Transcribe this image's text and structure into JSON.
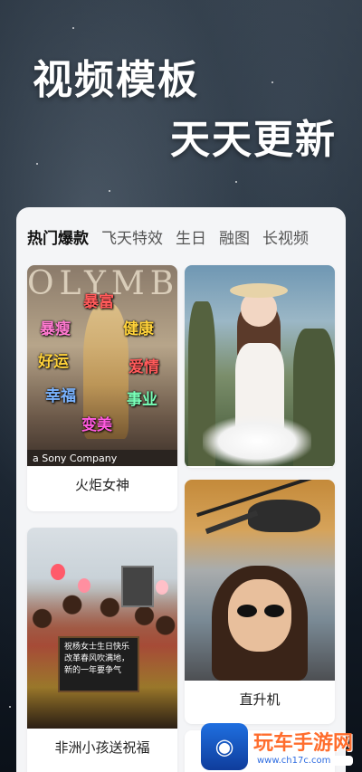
{
  "hero": {
    "line1": "视频模板",
    "line2": "天天更新"
  },
  "tabs": [
    {
      "label": "热门爆款",
      "active": true
    },
    {
      "label": "飞天特效",
      "active": false
    },
    {
      "label": "生日",
      "active": false
    },
    {
      "label": "融图",
      "active": false
    },
    {
      "label": "长视频",
      "active": false
    }
  ],
  "cards": [
    {
      "caption": "火炬女神",
      "image": {
        "big_letters": "OLYMB",
        "labels": [
          "暴富",
          "暴瘦",
          "健康",
          "好运",
          "爱情",
          "幸福",
          "事业",
          "变美"
        ],
        "brand": "a Sony Company"
      }
    },
    {
      "caption": "",
      "image": {}
    },
    {
      "caption": "直升机",
      "image": {}
    },
    {
      "caption": "非洲小孩送祝福",
      "image": {
        "sign_text": "祝杨女士生日快乐\n改革春风吹满地，\n新的一年要争气"
      }
    }
  ],
  "logo": {
    "name": "玩车手游网",
    "url": "www.ch17c.com"
  },
  "colors": {
    "panel_bg": "#f4f5f7",
    "active_tab": "#111111",
    "inactive_tab": "#555555",
    "logo_orange": "#ff6d2d",
    "logo_blue": "#2f6de1"
  }
}
